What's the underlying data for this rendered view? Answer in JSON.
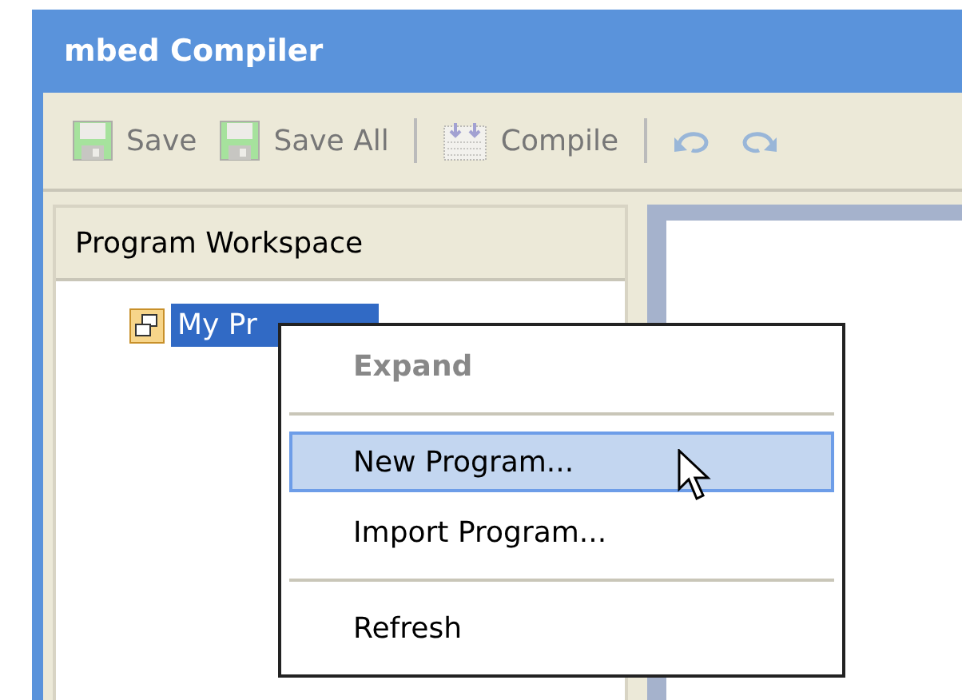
{
  "window": {
    "title": "mbed Compiler"
  },
  "toolbar": [
    {
      "kind": "save",
      "label": "Save",
      "disabled": true
    },
    {
      "kind": "save",
      "label": "Save All",
      "disabled": true
    },
    {
      "kind": "separator"
    },
    {
      "kind": "compile",
      "label": "Compile",
      "disabled": true
    },
    {
      "kind": "separator"
    },
    {
      "kind": "undo",
      "disabled": true
    },
    {
      "kind": "redo",
      "disabled": true
    }
  ],
  "workspace": {
    "title": "Program Workspace",
    "tree": [
      {
        "label": "My Pr",
        "selected": true
      }
    ]
  },
  "context_menu": [
    {
      "kind": "item",
      "label": "Expand",
      "disabled": true,
      "bold": true,
      "selected": false
    },
    {
      "kind": "separator"
    },
    {
      "kind": "item",
      "label": "New Program...",
      "disabled": false,
      "bold": false,
      "selected": true
    },
    {
      "kind": "item",
      "label": "Import Program...",
      "disabled": false,
      "bold": false,
      "selected": false
    },
    {
      "kind": "separator"
    },
    {
      "kind": "item",
      "label": "Refresh",
      "disabled": false,
      "bold": false,
      "selected": false
    }
  ]
}
